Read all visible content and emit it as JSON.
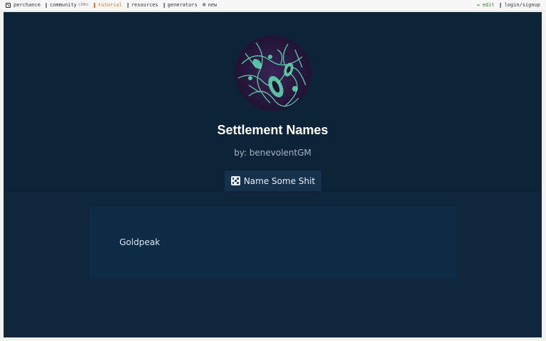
{
  "nav": {
    "left": [
      {
        "name": "perchance",
        "label": "perchance",
        "icon": "dice-icon"
      },
      {
        "name": "community",
        "label": "community",
        "note": "(10h)",
        "icon": "chat-icon"
      },
      {
        "name": "tutorial",
        "label": "tutorial",
        "icon": "book-icon"
      },
      {
        "name": "resources",
        "label": "resources",
        "icon": "book-icon"
      },
      {
        "name": "generators",
        "label": "generators",
        "icon": "grid-icon"
      },
      {
        "name": "new",
        "label": "new",
        "icon": "plus-circle-icon"
      }
    ],
    "right": [
      {
        "name": "edit",
        "label": "edit",
        "icon": "pencil-icon"
      },
      {
        "name": "login",
        "label": "login/signup",
        "icon": "user-icon"
      }
    ],
    "glyphs": {
      "new": "⊕",
      "edit": "✏"
    }
  },
  "generator": {
    "title": "Settlement Names",
    "byline": "by: benevolentGM",
    "button_label": "Name Some Shit",
    "button_icon": "dice-icon",
    "output": "Goldpeak"
  },
  "colors": {
    "background": "#10263c",
    "hero": "#0d2338",
    "output_box": "#0e2b46",
    "tutorial_link": "#e07a1a",
    "edit_link": "#2e8b2e",
    "avatar_accent": "#5fe0b4",
    "avatar_dark": "#2a1a3e"
  }
}
